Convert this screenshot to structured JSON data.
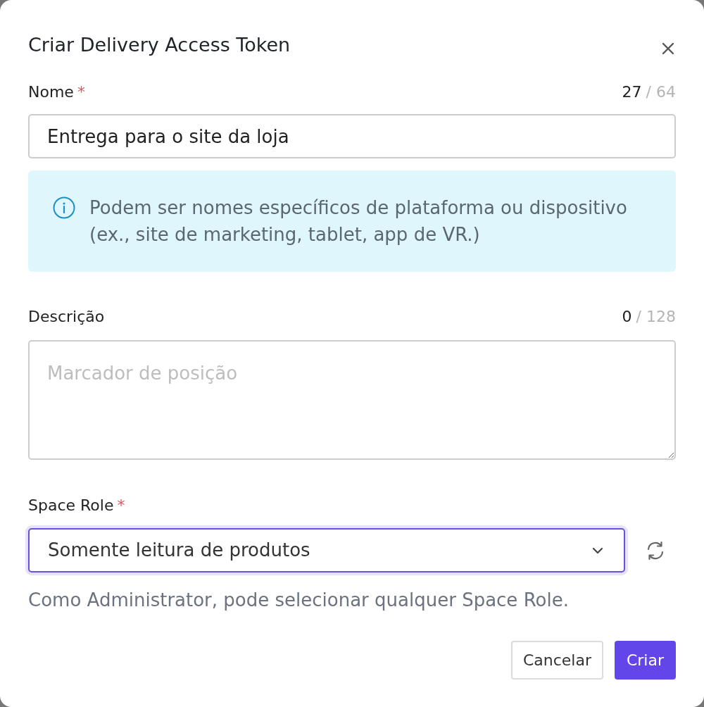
{
  "dialog": {
    "title": "Criar Delivery Access Token"
  },
  "fields": [
    {
      "kind": "text",
      "label": "Nome",
      "required_mark": "*",
      "count": "27",
      "limit": "/ 64",
      "value": "Entrega para o site da loja"
    },
    {
      "kind": "note",
      "text": "Podem ser nomes específicos de plataforma ou dispositivo (ex., site de marketing, tablet, app de VR.)"
    },
    {
      "kind": "textarea",
      "label": "Descrição",
      "count": "0",
      "limit": "/ 128",
      "placeholder": "Marcador de posição"
    },
    {
      "kind": "select",
      "label": "Space Role",
      "required_mark": "*",
      "value": "Somente leitura de produtos",
      "focused": true,
      "help": "Como Administrator, pode selecionar qualquer Space Role."
    }
  ],
  "buttons": [
    {
      "label": "Cancelar",
      "kind": "secondary"
    },
    {
      "label": "Criar",
      "kind": "primary"
    }
  ]
}
